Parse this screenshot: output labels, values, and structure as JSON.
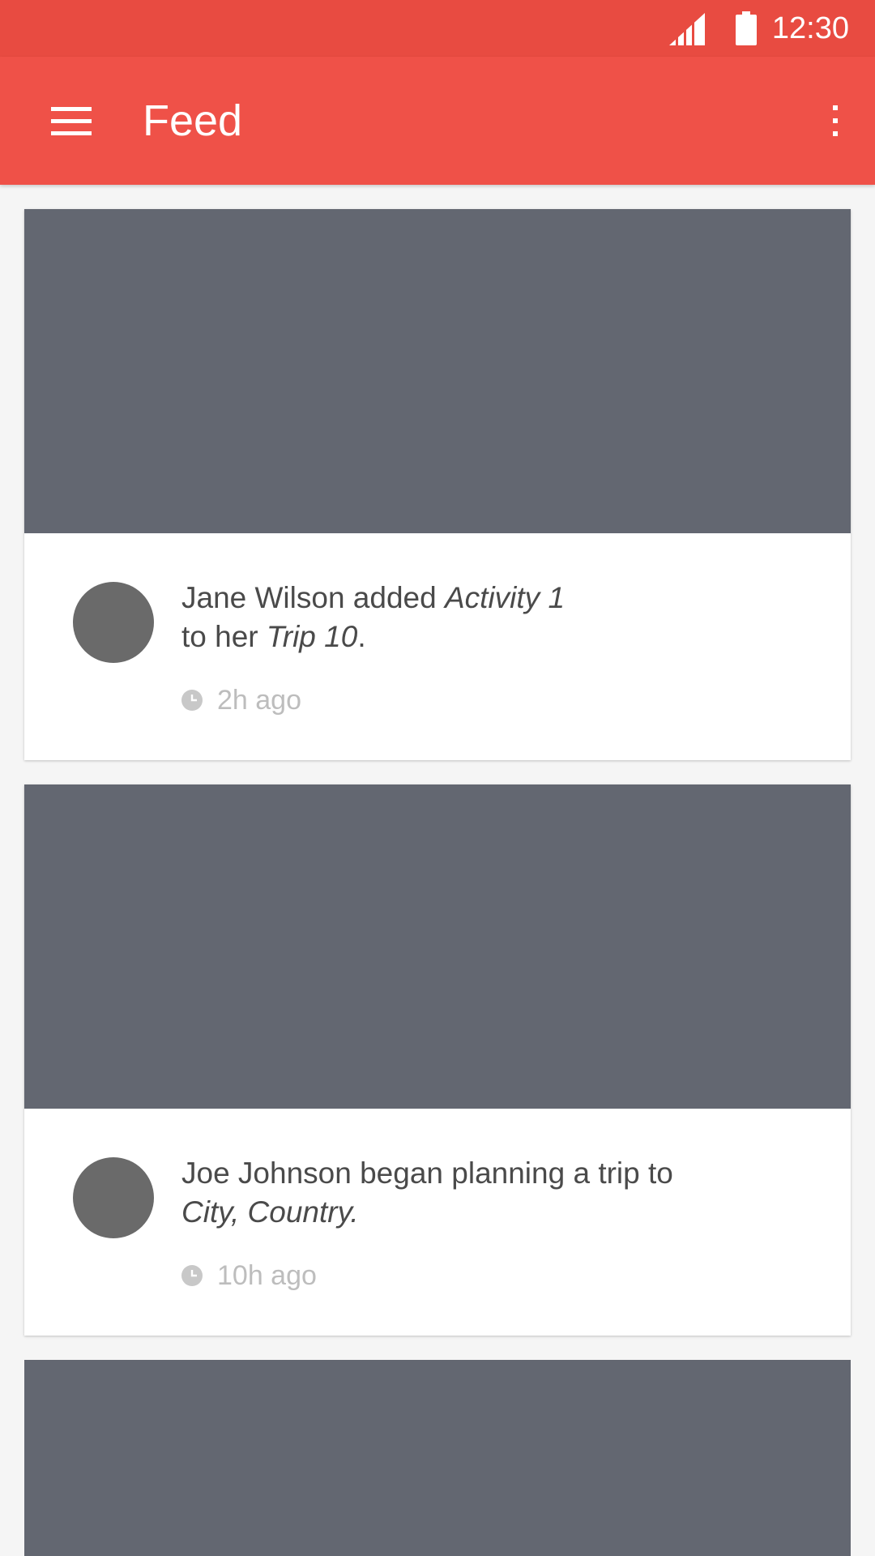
{
  "status_bar": {
    "time": "12:30",
    "signal_icon": "signal-icon",
    "battery_icon": "battery-icon"
  },
  "app_bar": {
    "title": "Feed",
    "menu_icon": "hamburger-menu-icon",
    "overflow_icon": "more-vert-icon"
  },
  "colors": {
    "status_bar": "#e84b41",
    "app_bar": "#ef5148",
    "card_image": "#636771",
    "avatar": "#6a6a6a",
    "background": "#f5f5f5"
  },
  "feed": [
    {
      "prefix": "Jane Wilson added ",
      "em1": "Activity 1",
      "mid": "to her ",
      "em2": "Trip 10",
      "suffix": ".",
      "time": "2h ago"
    },
    {
      "prefix": "Joe Johnson began planning a trip to",
      "em1": "City, Country.",
      "time": "10h ago"
    }
  ]
}
